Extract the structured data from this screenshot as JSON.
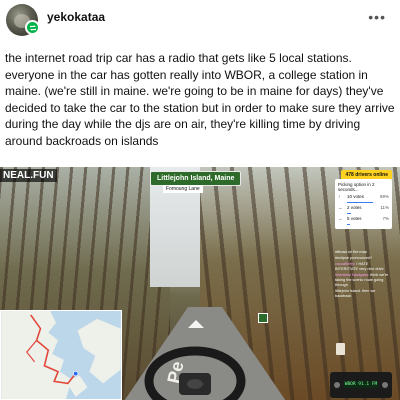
{
  "post": {
    "username": "yekokataa",
    "more_icon": "more-horizontal-icon",
    "text": "the internet road trip car has a radio that gets like 5 local stations. everyone in the car has gotten really into WBOR, a college station in maine. (we're still in maine. we're going to be in maine for days) they've decided to take the car to the station but in order to make sure they arrive during the day while the djs are on air, they're killing time by driving around backroads on islands"
  },
  "game": {
    "brand": "NEAL.FUN",
    "location_title": "Littlejohn Island, Maine",
    "location_sub": "Fomoung Lane",
    "road_text": "Pe",
    "drivers_badge": "478 drivers online",
    "poll": {
      "title": "Picking option in 2 seconds...",
      "options": [
        {
          "arrow": "↑",
          "label": "10 votes",
          "pct": "69%",
          "fraction": 0.69
        },
        {
          "arrow": "→",
          "label": "2 votes",
          "pct": "11%",
          "fraction": 0.11
        },
        {
          "arrow": "→",
          "label": "5 votes",
          "pct": "7%",
          "fraction": 0.07
        }
      ]
    },
    "chat": [
      {
        "user": "",
        "msg": "offroad on the map"
      },
      {
        "user": "",
        "msg": "#eclipse pronounced?"
      },
      {
        "user": "cocoaBerry: ",
        "msg": "I HATE INTERSTATE very nice drive"
      },
      {
        "user": "Interstate Navigator: ",
        "msg": "think we're taking the scenic route going through"
      },
      {
        "user": "",
        "msg": "littlejohn island. then we backtrack"
      }
    ],
    "radio": {
      "display": "WBOR 91.1 FM"
    }
  },
  "colors": {
    "accent_green": "#00b24a",
    "sign_green": "#2e6b2a",
    "badge_yellow": "#ffd21f"
  }
}
